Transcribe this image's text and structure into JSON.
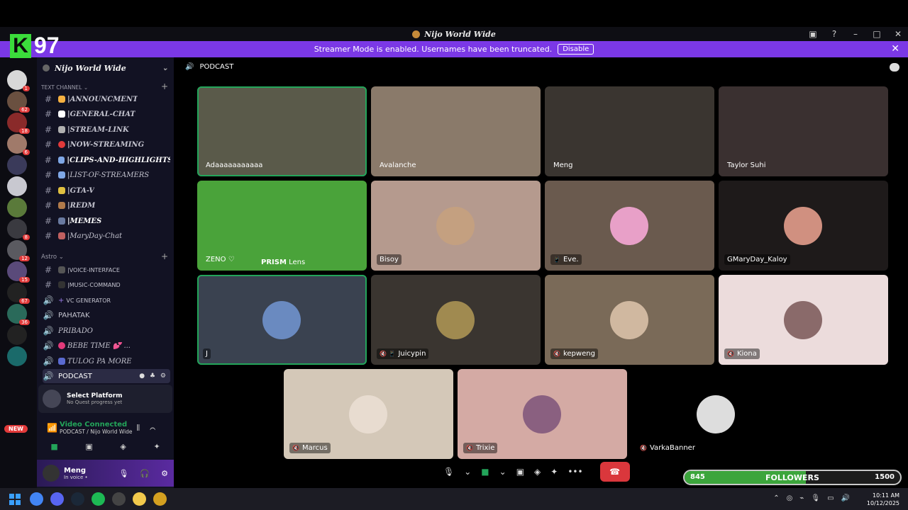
{
  "overlay": {
    "brand_letter": "K",
    "brand_number": "97"
  },
  "window": {
    "title": "Nijo World Wide",
    "controls": [
      "screen-share-icon",
      "help-icon",
      "minimize-icon",
      "maximize-icon",
      "close-icon"
    ]
  },
  "streamer_banner": {
    "text": "Streamer Mode is enabled. Usernames have been truncated.",
    "button": "Disable"
  },
  "server": {
    "name": "Nijo World Wide"
  },
  "rail_badges": [
    "1",
    "62",
    "18",
    "6",
    "8",
    "12",
    "15",
    "67",
    "36"
  ],
  "rail_new": "NEW",
  "sidebar": {
    "text_category": "Text Channel",
    "text_channels": [
      {
        "label": "|ANNOUNCMENT",
        "emoji_color": "#f5b041"
      },
      {
        "label": "|GENERAL-CHAT",
        "emoji_color": "#ffffff"
      },
      {
        "label": "|STREAM-LINK",
        "emoji_color": "#b0b0b0"
      },
      {
        "label": "|NOW-STREAMING",
        "emoji_color": "#e23a3a"
      },
      {
        "label": "|CLIPS-AND-HIGHLIGHTS",
        "emoji_color": "#7fa7e6"
      },
      {
        "label": "|LIST-OF-STREAMERS",
        "emoji_color": "#7fa7e6"
      },
      {
        "label": "|GTA-V",
        "emoji_color": "#e0c040"
      },
      {
        "label": "|REDM",
        "emoji_color": "#b07a4a"
      },
      {
        "label": "|MEMES",
        "emoji_color": "#6a7aa0"
      },
      {
        "label": "|MaryDay-Chat",
        "emoji_color": "#c06060"
      }
    ],
    "astro_category": "Astro",
    "astro_channels": [
      {
        "label": "|VOICE-INTERFACE",
        "icon": "hash"
      },
      {
        "label": "|MUSIC-COMMAND",
        "icon": "hash"
      },
      {
        "label": "VC GENERATOR",
        "icon": "plus"
      }
    ],
    "voice_channels": [
      {
        "label": "PAHATAK",
        "styled": false
      },
      {
        "label": "PRIBADO",
        "styled": true
      },
      {
        "label": "BEBE TIME 💕 ...",
        "styled": true
      },
      {
        "label": "TULOG PA MORE",
        "styled": true
      },
      {
        "label": "PODCAST",
        "styled": false
      }
    ],
    "quest": {
      "title": "Select Platform",
      "subtitle": "No Quest progress yet"
    },
    "voice_connected": {
      "status": "Video Connected",
      "location": "PODCAST / Nijo World Wide"
    },
    "user": {
      "name": "Meng",
      "status": "In voice •"
    }
  },
  "main": {
    "channel_title": "PODCAST",
    "participants": [
      {
        "name": "Adaaaaaaaaaaa",
        "bg": "#5a5a4a",
        "speaking": true,
        "video": true
      },
      {
        "name": "Avalanche",
        "bg": "#8a7a6a",
        "speaking": false,
        "video": true
      },
      {
        "name": "Meng",
        "bg": "#3a3530",
        "speaking": false,
        "video": true
      },
      {
        "name": "Taylor Suhi",
        "bg": "#3a3030",
        "speaking": false,
        "video": true
      },
      {
        "name": "ZENO ♡",
        "bg": "#4aa33a",
        "speaking": false,
        "video": true,
        "overlay": "PRISM",
        "overlay2": "Lens"
      },
      {
        "name": "Bisoy",
        "bg": "#b59a8e",
        "speaking": false,
        "avatar": "#c4a080"
      },
      {
        "name": "Eve.",
        "bg": "#6a5a4e",
        "speaking": false,
        "avatar": "#e8a0c8",
        "prefix": "📱"
      },
      {
        "name": "GMaryDay_Kaloy",
        "bg": "#1e1a1a",
        "speaking": false,
        "avatar": "#d09080"
      },
      {
        "name": "J",
        "bg": "#3a4250",
        "speaking": true,
        "avatar": "#6a8ac0"
      },
      {
        "name": "Juicypin",
        "bg": "#3a3530",
        "speaking": false,
        "avatar": "#a08a50",
        "prefix": "🔇 📱"
      },
      {
        "name": "kepweng",
        "bg": "#7a6a58",
        "speaking": false,
        "avatar": "#d0b8a0",
        "prefix": "🔇"
      },
      {
        "name": "Kiona",
        "bg": "#ecdcdc",
        "speaking": false,
        "avatar": "#8a6a6a",
        "prefix": "🔇"
      },
      {
        "name": "Marcus",
        "bg": "#d4c8b8",
        "speaking": false,
        "avatar": "#e8dcd0",
        "prefix": "🔇"
      },
      {
        "name": "Trixie",
        "bg": "#d4aaa4",
        "speaking": false,
        "avatar": "#8a6080",
        "prefix": "🔇"
      },
      {
        "name": "VarkaBanner",
        "bg": "#000000",
        "speaking": false,
        "avatar": "#dddddd",
        "prefix": "🔇"
      }
    ],
    "controls": [
      "mic-icon",
      "chevron-down-icon",
      "camera-icon",
      "chevron-down-icon",
      "screen-share-icon",
      "activity-icon",
      "soundboard-icon",
      "more-icon",
      "end-call-icon"
    ]
  },
  "followers_goal": {
    "current": "845",
    "label": "FOLLOWERS",
    "target": "1500",
    "progress": 0.563
  },
  "taskbar": {
    "apps": [
      "#4285f4",
      "#5865f2",
      "#1b2838",
      "#1db954",
      "#444444",
      "#f2c94c",
      "#d4a020"
    ],
    "time": "10:11 AM",
    "date": "10/12/2025"
  },
  "colors": {
    "accent": "#7b38e6",
    "green": "#23a55a",
    "danger": "#da373c"
  }
}
